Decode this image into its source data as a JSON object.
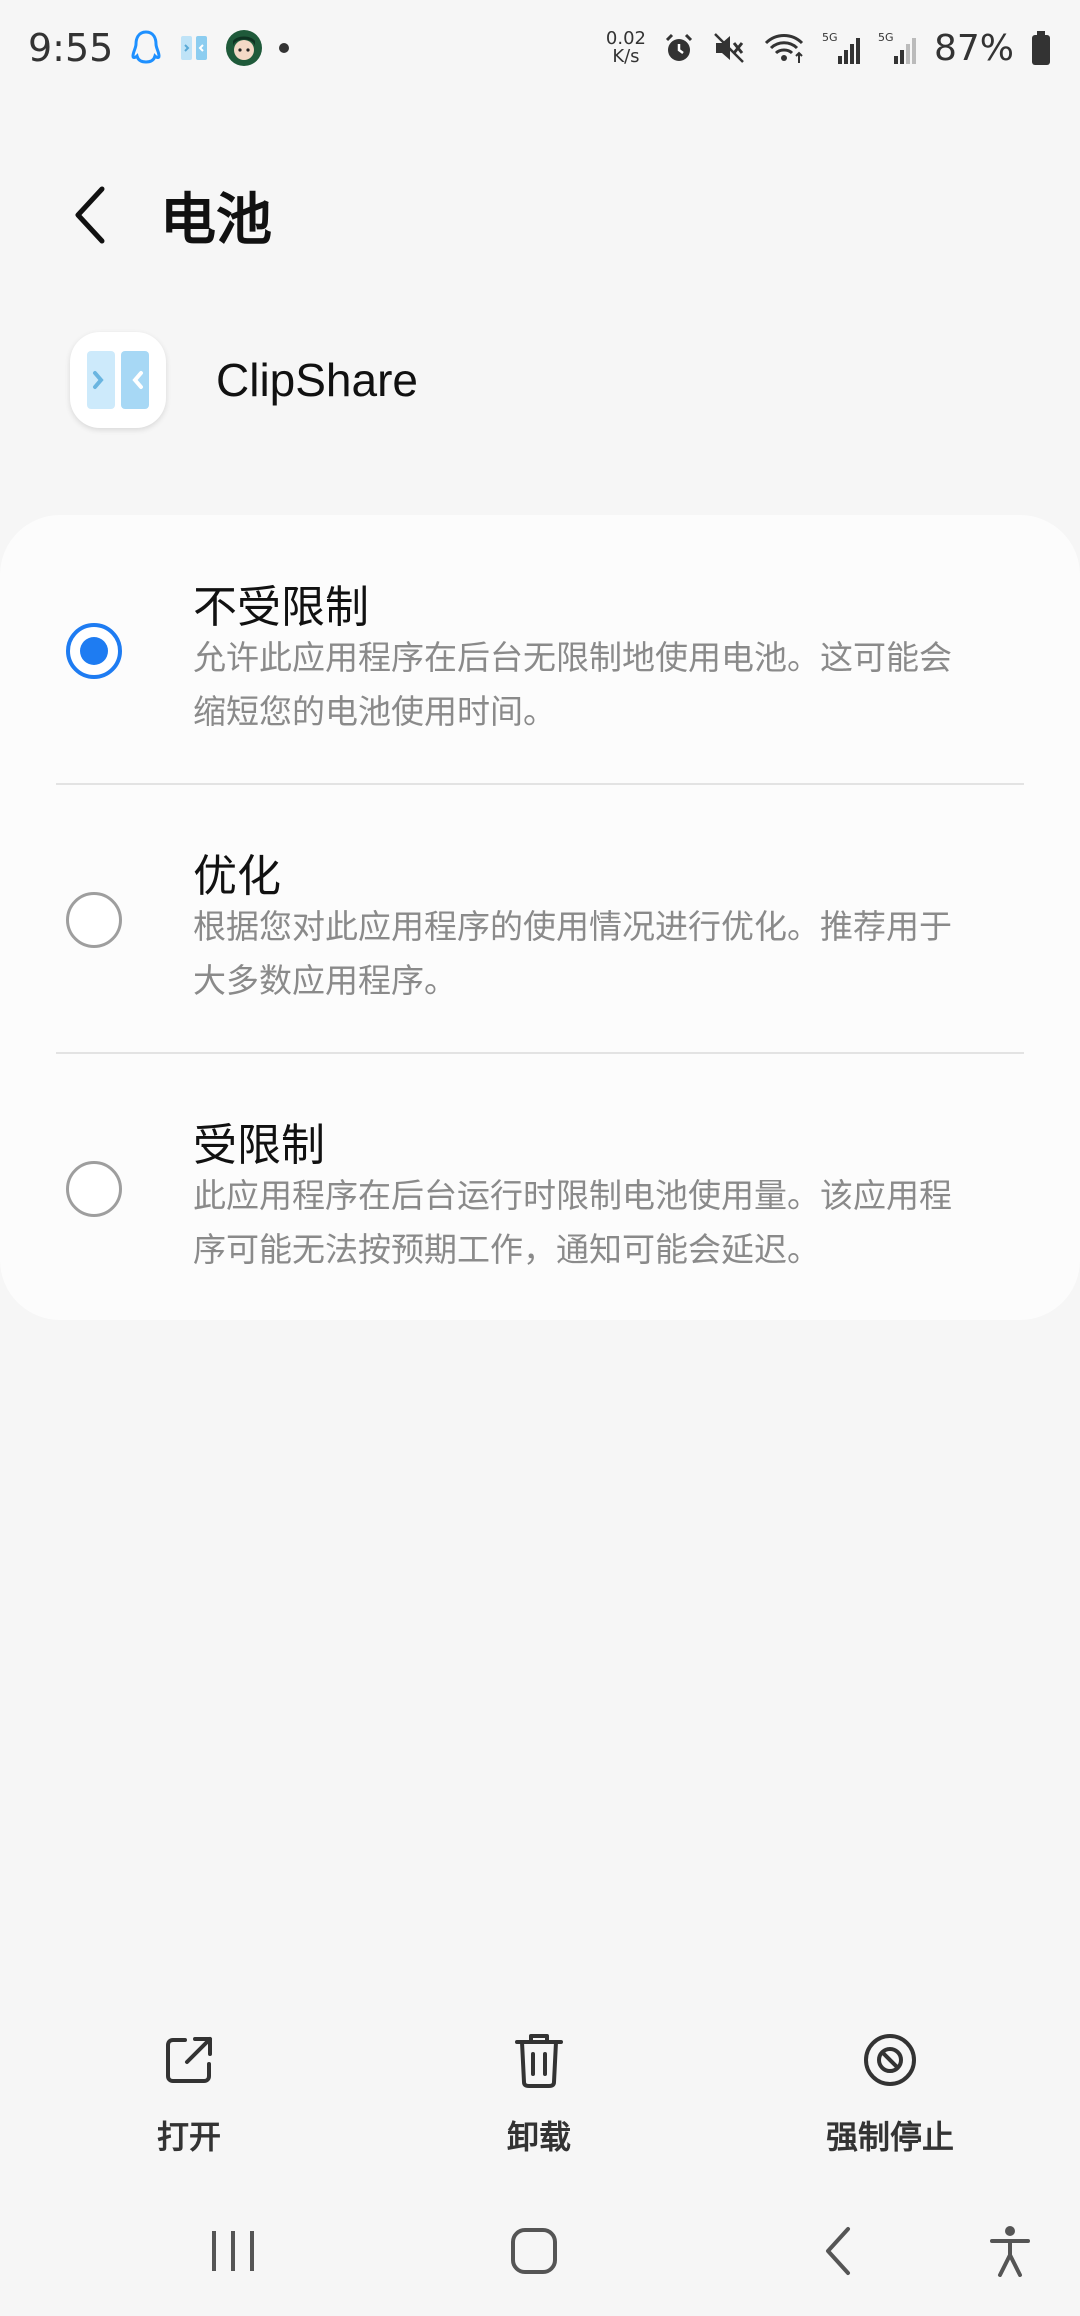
{
  "status_bar": {
    "time": "9:55",
    "net_speed_value": "0.02",
    "net_speed_unit": "K/s",
    "signal1_label": "5G",
    "signal2_label": "5G",
    "battery_percent": "87%"
  },
  "header": {
    "title": "电池"
  },
  "app": {
    "name": "ClipShare"
  },
  "options": [
    {
      "title": "不受限制",
      "description": "允许此应用程序在后台无限制地使用电池。这可能会缩短您的电池使用时间。",
      "selected": true
    },
    {
      "title": "优化",
      "description": "根据您对此应用程序的使用情况进行优化。推荐用于大多数应用程序。",
      "selected": false
    },
    {
      "title": "受限制",
      "description": "此应用程序在后台运行时限制电池使用量。该应用程序可能无法按预期工作，通知可能会延迟。",
      "selected": false
    }
  ],
  "actions": {
    "open_label": "打开",
    "uninstall_label": "卸载",
    "force_stop_label": "强制停止"
  },
  "colors": {
    "accent": "#1e7cf2",
    "background": "#f6f6f6",
    "card": "#fcfcfc",
    "secondary_text": "#8a8a8a"
  }
}
